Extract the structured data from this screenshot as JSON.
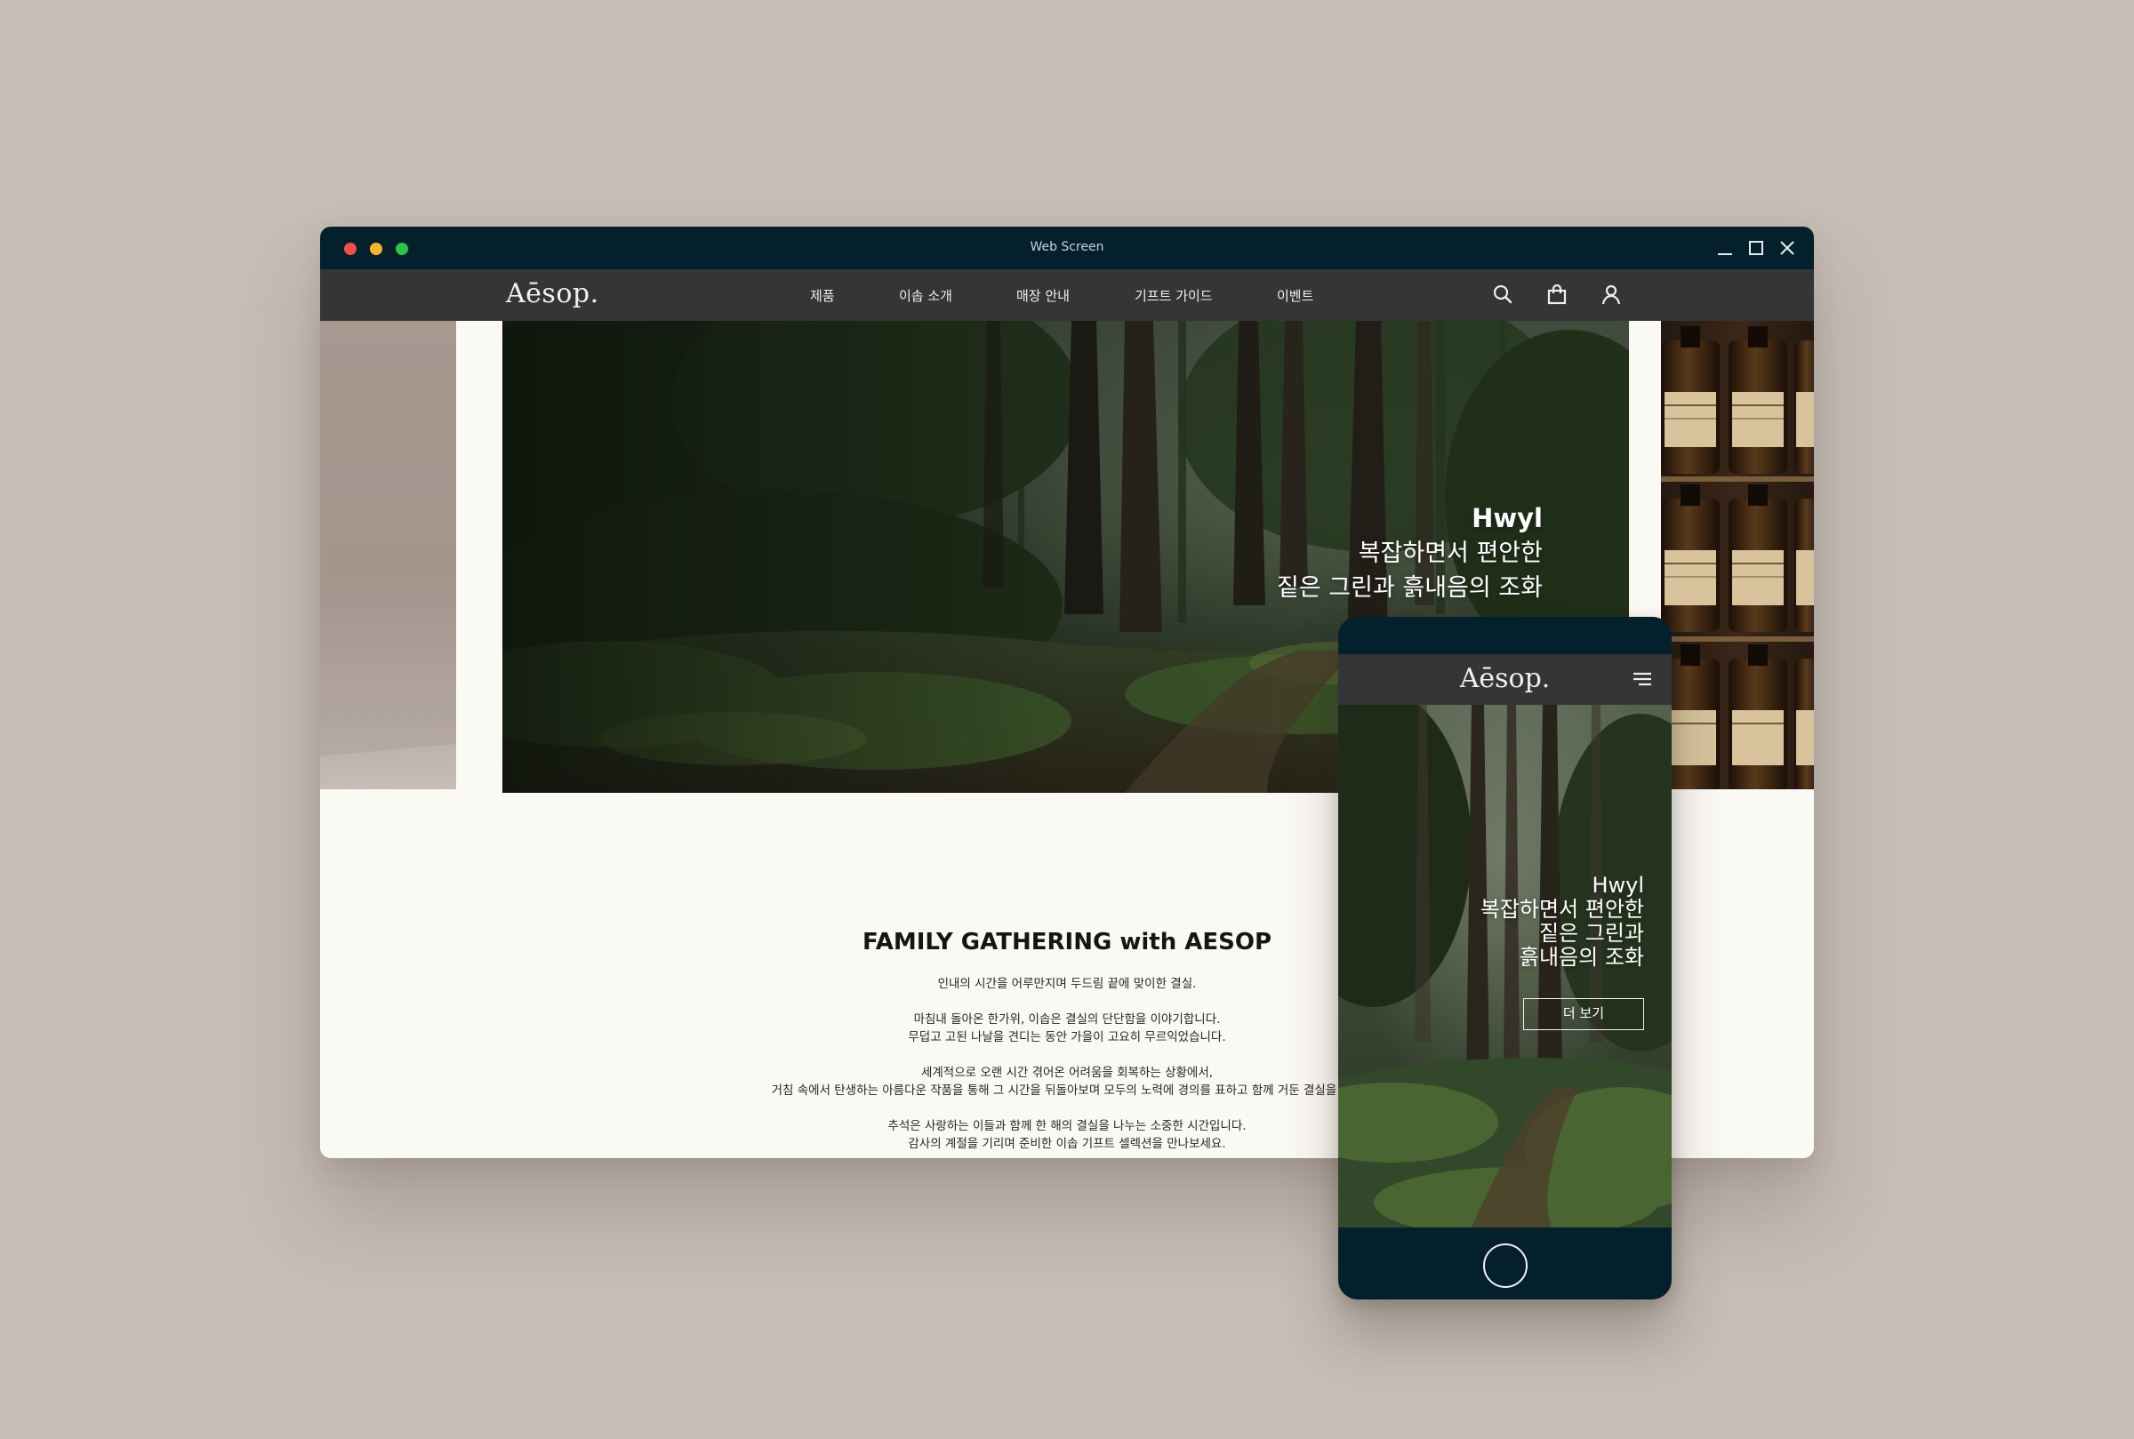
{
  "window": {
    "title": "Web Screen"
  },
  "brand": {
    "logo": "Aēsop."
  },
  "nav": {
    "items": [
      "제품",
      "이솝 소개",
      "매장 안내",
      "기프트 가이드",
      "이벤트"
    ],
    "icons": [
      "search-icon",
      "shopping-bag-icon",
      "user-icon"
    ]
  },
  "hero": {
    "headline": "Hwyl",
    "line1": "복잡하면서 편안한",
    "line2": "짙은 그린과 흙내음의 조화"
  },
  "section": {
    "title": "FAMILY GATHERING with AESOP",
    "paragraphs": [
      [
        "인내의 시간을 어루만지며 두드림 끝에 맞이한 결실."
      ],
      [
        "마침내 돌아온 한가위, 이솝은 결실의 단단함을 이야기합니다.",
        "무덥고 고된 나날을 견디는 동안 가을이 고요히 무르익었습니다."
      ],
      [
        "세계적으로 오랜 시간 겪어온 어려움을 회복하는 상황에서,",
        "거침 속에서 탄생하는 아름다운 작품을 통해 그 시간을 뒤돌아보며 모두의 노력에 경의를 표하고 함께 거둔 결실을 떠올"
      ],
      [
        "추석은 사랑하는 이들과 함께 한 해의 결실을 나누는 소중한 시간입니다.",
        "감사의 계절을 기리며 준비한 이솝 기프트 셀렉션을 만나보세요."
      ]
    ]
  },
  "mobile": {
    "logo": "Aēsop.",
    "hero": {
      "headline": "Hwyl",
      "line1": "복잡하면서 편안한",
      "line2": "짙은 그린과",
      "line3": "흙내음의 조화"
    },
    "cta_label": "더 보기"
  },
  "colors": {
    "titlebar": "#04202c",
    "navbar": "#343536",
    "page_bg": "#fbf9f3",
    "backdrop": "#c6bdb6"
  }
}
